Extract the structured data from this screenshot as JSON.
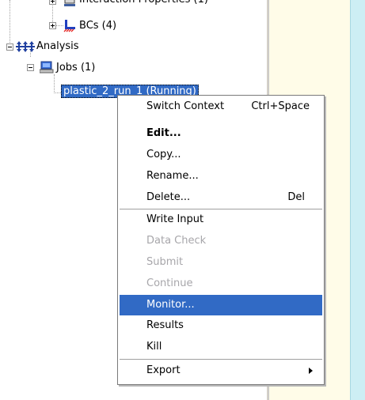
{
  "tree": {
    "partial_top_label": "Interaction Properties (1)",
    "bcs_label": "BCs (4)",
    "analysis_label": "Analysis",
    "jobs_label": "Jobs (1)",
    "selected_job_label": "plastic_2_run_1 (Running)"
  },
  "context_menu": {
    "items": [
      {
        "label": "Switch Context",
        "shortcut": "Ctrl+Space",
        "state": "normal"
      },
      {
        "label": "Edit...",
        "shortcut": "",
        "state": "bold"
      },
      {
        "label": "Copy...",
        "shortcut": "",
        "state": "normal"
      },
      {
        "label": "Rename...",
        "shortcut": "",
        "state": "normal"
      },
      {
        "label": "Delete...",
        "shortcut": "Del",
        "state": "normal"
      },
      {
        "label": "Write Input",
        "shortcut": "",
        "state": "normal"
      },
      {
        "label": "Data Check",
        "shortcut": "",
        "state": "disabled"
      },
      {
        "label": "Submit",
        "shortcut": "",
        "state": "disabled"
      },
      {
        "label": "Continue",
        "shortcut": "",
        "state": "disabled"
      },
      {
        "label": "Monitor...",
        "shortcut": "",
        "state": "highlighted"
      },
      {
        "label": "Results",
        "shortcut": "",
        "state": "normal"
      },
      {
        "label": "Kill",
        "shortcut": "",
        "state": "normal"
      },
      {
        "label": "Export",
        "shortcut": "",
        "state": "normal",
        "submenu": true
      }
    ]
  },
  "colors": {
    "selection": "#316ac5",
    "disabled_text": "#a7a6aa",
    "right_panel": "#fffce8",
    "right_edge": "#cdeef4"
  }
}
